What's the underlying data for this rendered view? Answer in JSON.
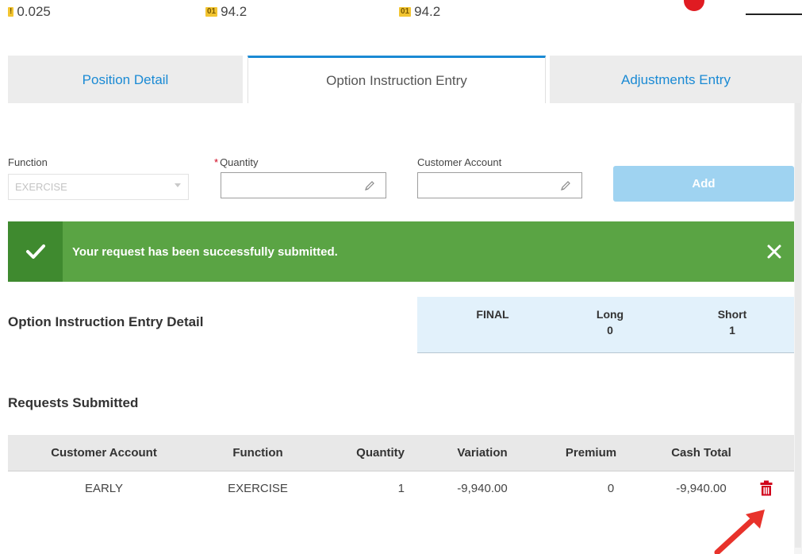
{
  "ticker": [
    {
      "badge": "!",
      "value": "0.025",
      "badge_color": "#f3c531"
    },
    {
      "badge": "01",
      "value": "94.2",
      "badge_color": "#f3c531"
    },
    {
      "badge": "01",
      "value": "94.2",
      "badge_color": "#f3c531"
    }
  ],
  "tabs": [
    {
      "label": "Position Detail",
      "active": false
    },
    {
      "label": "Option Instruction Entry",
      "active": true
    },
    {
      "label": "Adjustments Entry",
      "active": false
    }
  ],
  "form": {
    "function_label": "Function",
    "function_value": "EXERCISE",
    "quantity_required_mark": "*",
    "quantity_label": "Quantity",
    "quantity_value": "",
    "customer_account_label": "Customer Account",
    "customer_account_value": "",
    "add_label": "Add"
  },
  "alert": {
    "message": "Your request has been successfully submitted.",
    "type": "success",
    "color": "#5aa444"
  },
  "detail": {
    "title": "Option Instruction Entry Detail",
    "summary": {
      "final_label": "FINAL",
      "long_label": "Long",
      "long_value": "0",
      "short_label": "Short",
      "short_value": "1"
    }
  },
  "requests": {
    "title": "Requests Submitted",
    "columns": [
      "Customer Account",
      "Function",
      "Quantity",
      "Variation",
      "Premium",
      "Cash Total"
    ],
    "rows": [
      {
        "customer_account": "EARLY",
        "function": "EXERCISE",
        "quantity": "1",
        "variation": "-9,940.00",
        "premium": "0",
        "cash_total": "-9,940.00"
      }
    ]
  },
  "colors": {
    "accent": "#1a8ad4",
    "add_button": "#9fd3f1",
    "delete_icon": "#d0021b",
    "annotation_arrow": "#e8322b"
  }
}
